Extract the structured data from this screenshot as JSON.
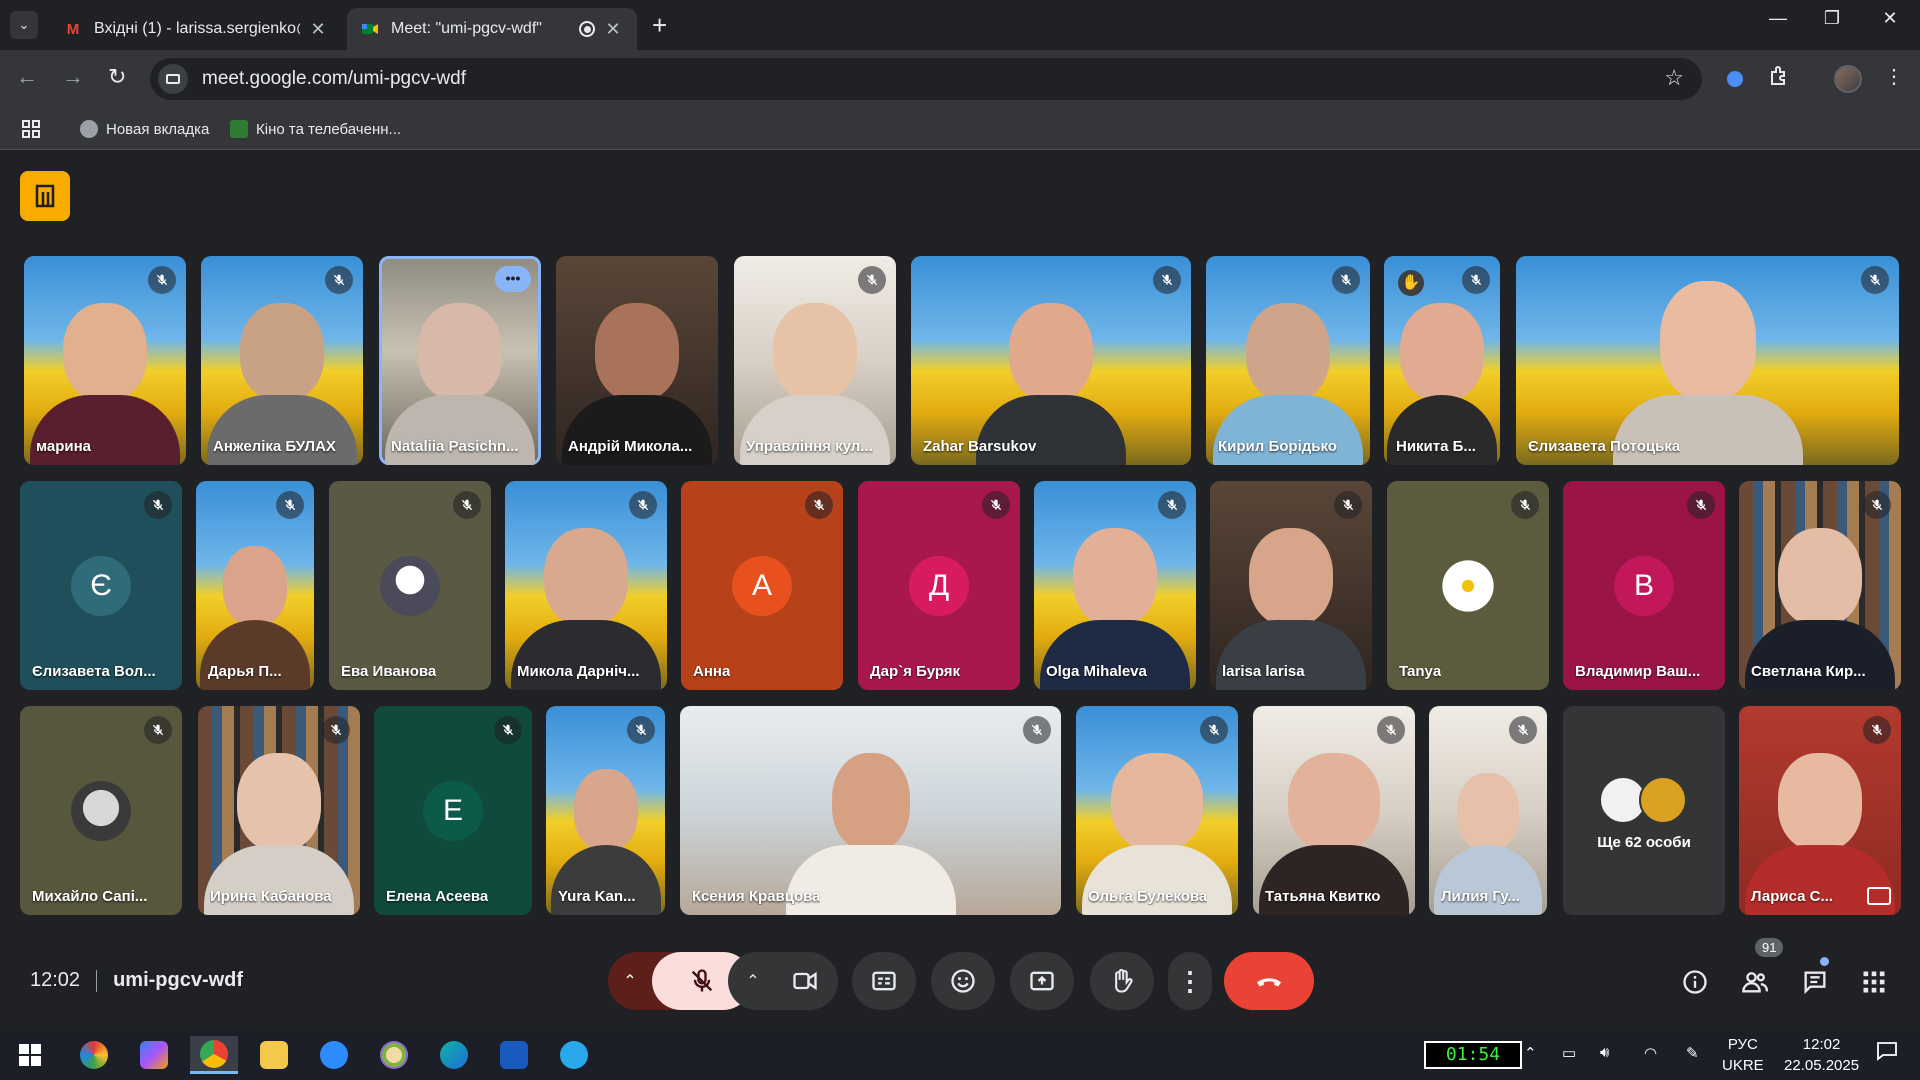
{
  "browser": {
    "tabs": [
      {
        "title": "Вхідні (1) - larissa.sergienko@g",
        "favicon": "gmail-icon"
      },
      {
        "title": "Meet: \"umi-pgcv-wdf\"",
        "favicon": "meet-icon"
      }
    ],
    "url": "meet.google.com/umi-pgcv-wdf",
    "bookmarks": [
      {
        "label": "Новая вкладка"
      },
      {
        "label": "Кіно та телебаченн..."
      }
    ]
  },
  "meeting": {
    "time": "12:02",
    "code": "umi-pgcv-wdf",
    "participant_count": "91",
    "overflow_label": "Ще 62 особи",
    "participants": [
      {
        "name": "марина",
        "type": "video"
      },
      {
        "name": "Анжеліка БУЛАХ",
        "type": "video"
      },
      {
        "name": "Nataliia Pasichn...",
        "type": "video",
        "pinned": true
      },
      {
        "name": "Андрій Микола...",
        "type": "video"
      },
      {
        "name": "Управління кул...",
        "type": "video"
      },
      {
        "name": "Zahar Barsukov",
        "type": "video"
      },
      {
        "name": "Кирил Борідько",
        "type": "video"
      },
      {
        "name": "Никита Б...",
        "type": "video",
        "hand_raised": true
      },
      {
        "name": "Єлизавета Потоцька",
        "type": "video"
      },
      {
        "name": "Єлизавета Вол...",
        "type": "initial",
        "initial": "Є",
        "color": "#1f4f5a"
      },
      {
        "name": "Дарья П...",
        "type": "video"
      },
      {
        "name": "Ева Иванова",
        "type": "avatar"
      },
      {
        "name": "Микола Дарнiч...",
        "type": "video"
      },
      {
        "name": "Анна",
        "type": "initial",
        "initial": "А",
        "color": "#e8501e"
      },
      {
        "name": "Дар`я Буряк",
        "type": "initial",
        "initial": "Д",
        "color": "#d81b60"
      },
      {
        "name": "Olga Mihaleva",
        "type": "video"
      },
      {
        "name": "larisa larisa",
        "type": "video"
      },
      {
        "name": "Tanya",
        "type": "avatar"
      },
      {
        "name": "Владимир Ваш...",
        "type": "initial",
        "initial": "В",
        "color": "#c2185b"
      },
      {
        "name": "Светлана Кир...",
        "type": "video"
      },
      {
        "name": "Михайло Сапі...",
        "type": "avatar"
      },
      {
        "name": "Ирина Кабанова",
        "type": "video"
      },
      {
        "name": "Елена Асеева",
        "type": "initial",
        "initial": "Е",
        "color": "#0b5a4a"
      },
      {
        "name": "Yura Kan...",
        "type": "video"
      },
      {
        "name": "Ксения Кравцова",
        "type": "video"
      },
      {
        "name": "Ольга Булекова",
        "type": "video"
      },
      {
        "name": "Татьяна Квитко",
        "type": "video"
      },
      {
        "name": "Лилия Гу...",
        "type": "video"
      },
      {
        "name": "Лариса С...",
        "type": "video"
      }
    ]
  },
  "taskbar": {
    "timer": "01:54",
    "language_top": "РУС",
    "language_bottom": "UKRE",
    "clock_time": "12:02",
    "clock_date": "22.05.2025"
  },
  "colors": {
    "end_call": "#ea4335",
    "mic_off_active": "#f9dedc",
    "host_badge": "#f9ab00",
    "accent": "#8ab4f8"
  }
}
